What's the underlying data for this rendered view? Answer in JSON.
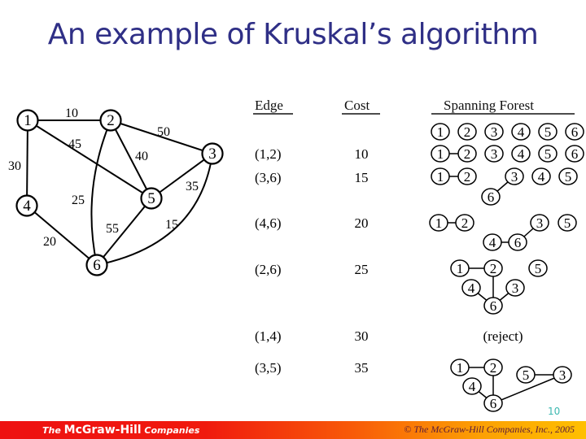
{
  "slide": {
    "title": "An example of Kruskal’s algorithm",
    "page_number": "10"
  },
  "graph": {
    "nodes": [
      {
        "id": "1",
        "label": "1"
      },
      {
        "id": "2",
        "label": "2"
      },
      {
        "id": "3",
        "label": "3"
      },
      {
        "id": "4",
        "label": "4"
      },
      {
        "id": "5",
        "label": "5"
      },
      {
        "id": "6",
        "label": "6"
      }
    ],
    "edges": [
      {
        "from": "1",
        "to": "2",
        "cost": "10"
      },
      {
        "from": "1",
        "to": "4",
        "cost": "30"
      },
      {
        "from": "1",
        "to": "5",
        "cost": "45"
      },
      {
        "from": "2",
        "to": "3",
        "cost": "50"
      },
      {
        "from": "2",
        "to": "5",
        "cost": "40"
      },
      {
        "from": "2",
        "to": "6",
        "cost": "25"
      },
      {
        "from": "3",
        "to": "5",
        "cost": "35"
      },
      {
        "from": "3",
        "to": "6",
        "cost": "15"
      },
      {
        "from": "4",
        "to": "6",
        "cost": "20"
      },
      {
        "from": "5",
        "to": "6",
        "cost": "55"
      }
    ]
  },
  "table": {
    "headers": {
      "edge": "Edge",
      "cost": "Cost",
      "forest": "Spanning Forest"
    },
    "steps": [
      {
        "edge": "",
        "cost": "",
        "forest_nodes": [
          "1",
          "2",
          "3",
          "4",
          "5",
          "6"
        ],
        "forest_edges": []
      },
      {
        "edge": "(1,2)",
        "cost": "10",
        "forest_nodes": [
          "1",
          "2",
          "3",
          "4",
          "5",
          "6"
        ],
        "forest_edges": [
          [
            "1",
            "2"
          ]
        ]
      },
      {
        "edge": "(3,6)",
        "cost": "15",
        "forest_nodes": [
          "1",
          "2",
          "3",
          "4",
          "5",
          "6"
        ],
        "forest_edges": [
          [
            "1",
            "2"
          ],
          [
            "3",
            "6"
          ]
        ]
      },
      {
        "edge": "(4,6)",
        "cost": "20",
        "forest_nodes": [
          "1",
          "2",
          "3",
          "4",
          "5",
          "6"
        ],
        "forest_edges": [
          [
            "1",
            "2"
          ],
          [
            "3",
            "6"
          ],
          [
            "4",
            "6"
          ]
        ]
      },
      {
        "edge": "(2,6)",
        "cost": "25",
        "forest_nodes": [
          "1",
          "2",
          "3",
          "4",
          "5",
          "6"
        ],
        "forest_edges": [
          [
            "1",
            "2"
          ],
          [
            "2",
            "6"
          ],
          [
            "3",
            "6"
          ],
          [
            "4",
            "6"
          ]
        ]
      },
      {
        "edge": "(1,4)",
        "cost": "30",
        "result": "(reject)"
      },
      {
        "edge": "(3,5)",
        "cost": "35",
        "forest_nodes": [
          "1",
          "2",
          "3",
          "4",
          "5",
          "6"
        ],
        "forest_edges": [
          [
            "1",
            "2"
          ],
          [
            "2",
            "6"
          ],
          [
            "3",
            "6"
          ],
          [
            "4",
            "6"
          ],
          [
            "3",
            "5"
          ]
        ]
      }
    ]
  },
  "footer": {
    "brand_prefix": "The",
    "brand_name": "McGraw-Hill",
    "brand_suffix": "Companies",
    "copyright": "© The McGraw-Hill Companies, Inc., 2005"
  },
  "colors": {
    "title": "#2f2f86",
    "page_number": "#3cb8b0",
    "footer_start": "#ee1111",
    "footer_end": "#ffc000"
  }
}
